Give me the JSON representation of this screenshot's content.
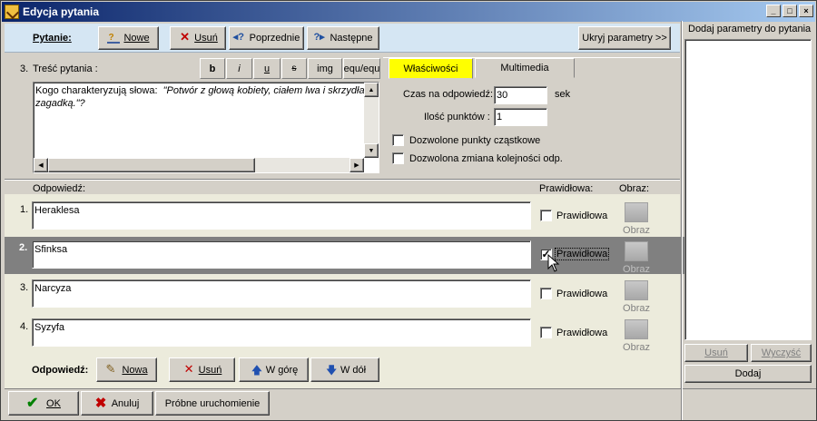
{
  "window": {
    "title": "Edycja pytania",
    "min_glyph": "_",
    "max_glyph": "□",
    "close_glyph": "×"
  },
  "toolbar": {
    "label": "Pytanie:",
    "new": "Nowe",
    "delete": "Usuń",
    "prev": "Poprzednie",
    "next": "Następne",
    "hide_params": "Ukryj parametry >>"
  },
  "question": {
    "number": "3.",
    "label": "Treść pytania :",
    "format_buttons": [
      "b",
      "i",
      "u",
      "s",
      "img",
      "equ/equ"
    ],
    "text_plain": "Kogo charakteryzują słowa:  ",
    "text_italic": "\"Potwór z głową kobiety, ciałem lwa i skrzydła",
    "text_line2": "zagadką.\"?"
  },
  "tabs": {
    "properties": "Właściwości",
    "multimedia": "Multimedia"
  },
  "properties": {
    "time_label": "Czas na odpowiedź:",
    "time_value": "30",
    "time_unit": "sek",
    "points_label": "Ilość punktów :",
    "points_value": "1",
    "partial_points": "Dozwolone punkty cząstkowe",
    "change_order": "Dozwolona zmiana kolejności odp."
  },
  "answers_header": {
    "answer": "Odpowiedź:",
    "correct": "Prawidłowa:",
    "image": "Obraz:"
  },
  "answers": [
    {
      "num": "1.",
      "text": "Heraklesa",
      "correct_label": "Prawidłowa",
      "image_label": "Obraz",
      "checked": false
    },
    {
      "num": "2.",
      "text": "Sfinksa",
      "correct_label": "Prawidłowa",
      "image_label": "Obraz",
      "checked": true
    },
    {
      "num": "3.",
      "text": "Narcyza",
      "correct_label": "Prawidłowa",
      "image_label": "Obraz",
      "checked": false
    },
    {
      "num": "4.",
      "text": "Syzyfa",
      "correct_label": "Prawidłowa",
      "image_label": "Obraz",
      "checked": false
    }
  ],
  "answer_toolbar": {
    "label": "Odpowiedź:",
    "new": "Nowa",
    "delete": "Usuń",
    "up": "W górę",
    "down": "W dół"
  },
  "footer": {
    "ok": "OK",
    "cancel": "Anuluj",
    "test_run": "Próbne uruchomienie"
  },
  "side_panel": {
    "title": "Dodaj parametry do pytania",
    "delete": "Usuń",
    "clear": "Wyczyść",
    "add": "Dodaj"
  },
  "colors": {
    "tab_active": "#ffff00",
    "toolbar_bg": "#d5e6f3",
    "answers_bg": "#ecebdc",
    "selected_row": "#808080"
  }
}
